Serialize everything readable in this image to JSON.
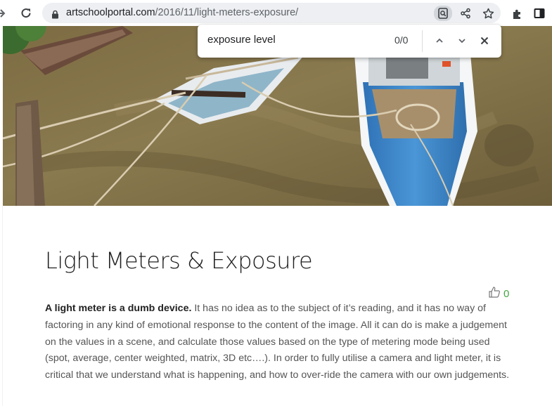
{
  "browser": {
    "url_domain": "artschoolportal.com",
    "url_path": "/2016/11/light-meters-exposure/"
  },
  "find_bar": {
    "query": "exposure level",
    "count": "0/0"
  },
  "article": {
    "title": "Light Meters & Exposure",
    "like_count": "0",
    "intro_bold": "A light meter is a dumb device.",
    "intro_rest": " It has no idea as to the subject of it’s reading, and it has no way of factoring in any kind of emotional response to the content of the image. All it can do is make a judgement on the values in a scene, and calculate those values based on the type of metering mode being used (spot, average, center weighted, matrix, 3D etc….). In order to fully utilise a camera and light meter, it is critical that we understand what is happening, and how to over-ride the camera with our own judgements."
  },
  "colors": {
    "accent_green": "#44a744",
    "omnibox_bg": "#edeff2",
    "boat_blue": "#3a86c8"
  }
}
